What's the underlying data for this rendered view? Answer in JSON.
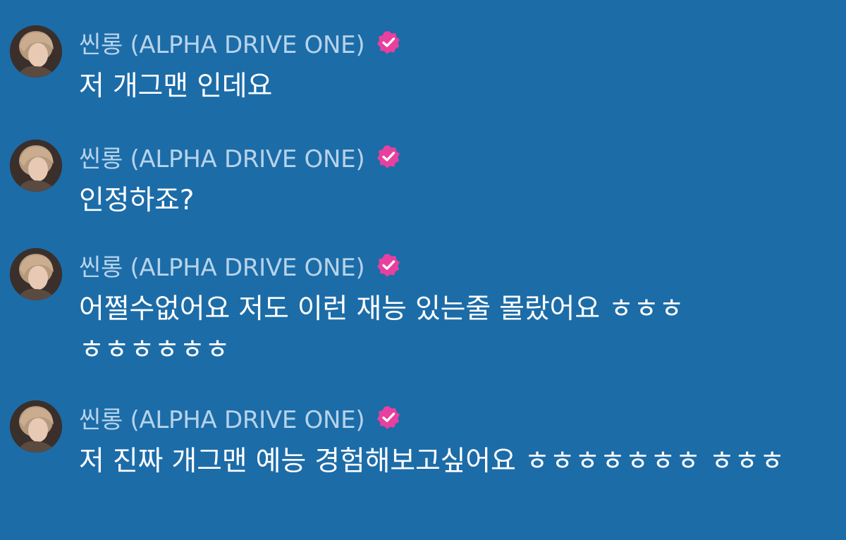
{
  "colors": {
    "background": "#1c6ca8",
    "username": "#b7d3ea",
    "message_text": "#ffffff",
    "badge": "#e8409e"
  },
  "messages": [
    {
      "username": "씬롱 (ALPHA DRIVE ONE)",
      "verified_icon": "verified-badge-icon",
      "text": "저 개그맨 인데요"
    },
    {
      "username": "씬롱 (ALPHA DRIVE ONE)",
      "verified_icon": "verified-badge-icon",
      "text": "인정하죠?"
    },
    {
      "username": "씬롱 (ALPHA DRIVE ONE)",
      "verified_icon": "verified-badge-icon",
      "text": "어쩔수없어요 저도 이런 재능 있는줄 몰랐어요 ㅎㅎㅎ ㅎㅎㅎㅎㅎㅎ"
    },
    {
      "username": "씬롱 (ALPHA DRIVE ONE)",
      "verified_icon": "verified-badge-icon",
      "text": "저 진짜 개그맨 예능 경험해보고싶어요 ㅎㅎㅎㅎㅎㅎㅎ ㅎㅎㅎ"
    }
  ]
}
